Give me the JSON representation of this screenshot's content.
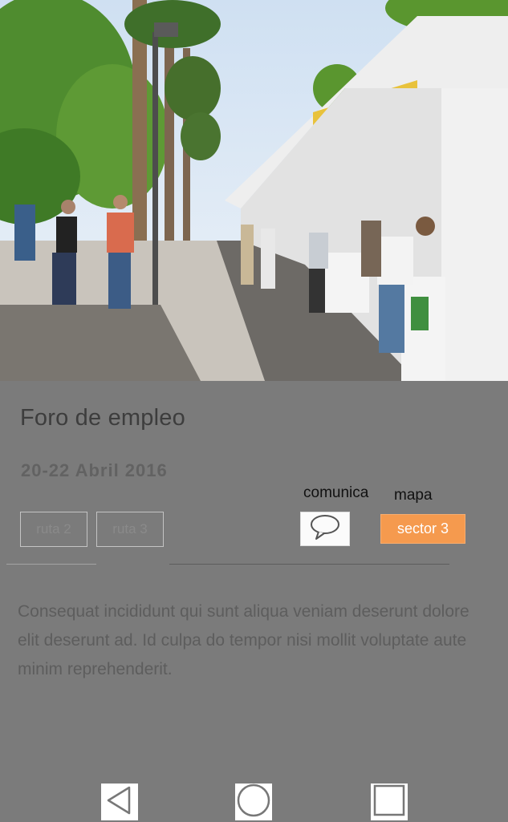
{
  "event": {
    "title": "Foro de empleo",
    "date": "20-22 Abril 2016",
    "description": "Consequat incididunt qui sunt aliqua veniam deserunt dolore elit deserunt ad. Id culpa do tempor nisi mollit voluptate aute minim reprehenderit."
  },
  "routes": [
    {
      "label": "ruta 2"
    },
    {
      "label": "ruta 3"
    }
  ],
  "actions": {
    "comunica_label": "comunica",
    "comunica_icon": "speech-bubble-icon",
    "mapa_label": "mapa",
    "sector_label": "sector 3"
  },
  "nav": {
    "back_icon": "back-triangle-icon",
    "home_icon": "home-circle-icon",
    "recents_icon": "recents-square-icon"
  },
  "colors": {
    "background": "#7b7b7b",
    "accent": "#f59a4e"
  }
}
